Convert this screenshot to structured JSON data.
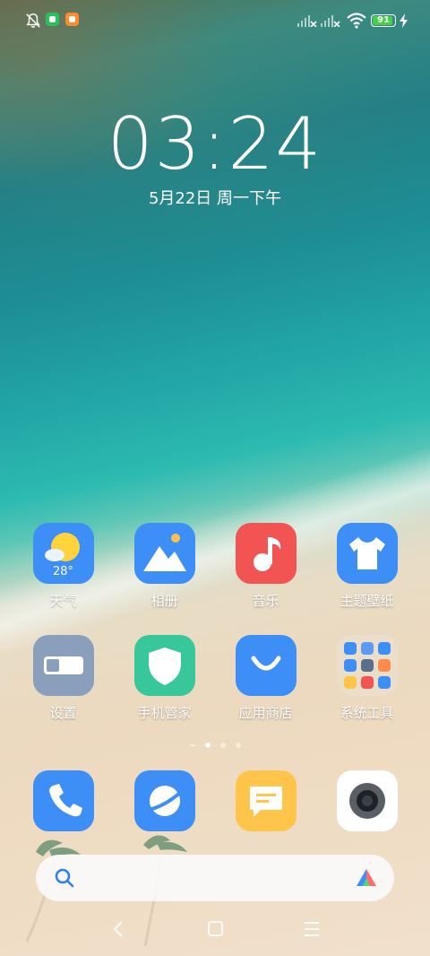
{
  "status_bar": {
    "icons": [
      "bell-muted-icon",
      "app-notification-green-icon",
      "app-notification-orange-icon",
      "signal-x-icon",
      "signal-x-icon",
      "wifi-icon",
      "battery-icon",
      "charging-bolt-icon"
    ],
    "battery_level": "91",
    "battery_fraction": 0.91,
    "battery_color": "#44d04a"
  },
  "clock": {
    "time": "03:24",
    "date": "5月22日 周一下午"
  },
  "apps": [
    {
      "label": "天气",
      "icon": "weather-icon",
      "extra": "28°",
      "color": "#3d8ef7"
    },
    {
      "label": "相册",
      "icon": "gallery-icon",
      "color": "#3d8ef7"
    },
    {
      "label": "音乐",
      "icon": "music-icon",
      "color": "#f25454"
    },
    {
      "label": "主题壁纸",
      "icon": "themes-icon",
      "color": "#3d8ef7"
    },
    {
      "label": "设置",
      "icon": "settings-icon",
      "color": "#8a9fbb"
    },
    {
      "label": "手机管家",
      "icon": "security-icon",
      "color": "#38c79a"
    },
    {
      "label": "应用商店",
      "icon": "app-store-icon",
      "color": "#3d8ef7"
    },
    {
      "label": "系统工具",
      "icon": "folder-icon",
      "color": "#e8e0d0"
    }
  ],
  "pages": {
    "count": 4,
    "active": 1
  },
  "dock": [
    {
      "icon": "phone-icon",
      "color": "#3d8ef7"
    },
    {
      "icon": "browser-icon",
      "color": "#3d8ef7"
    },
    {
      "icon": "messages-icon",
      "color": "#ffc54a"
    },
    {
      "icon": "camera-icon",
      "color": "#ffffff"
    }
  ],
  "search": {
    "icon": "search-icon",
    "assistant_icon": "assistant-icon"
  },
  "nav": [
    "back-icon",
    "home-icon",
    "menu-icon"
  ]
}
